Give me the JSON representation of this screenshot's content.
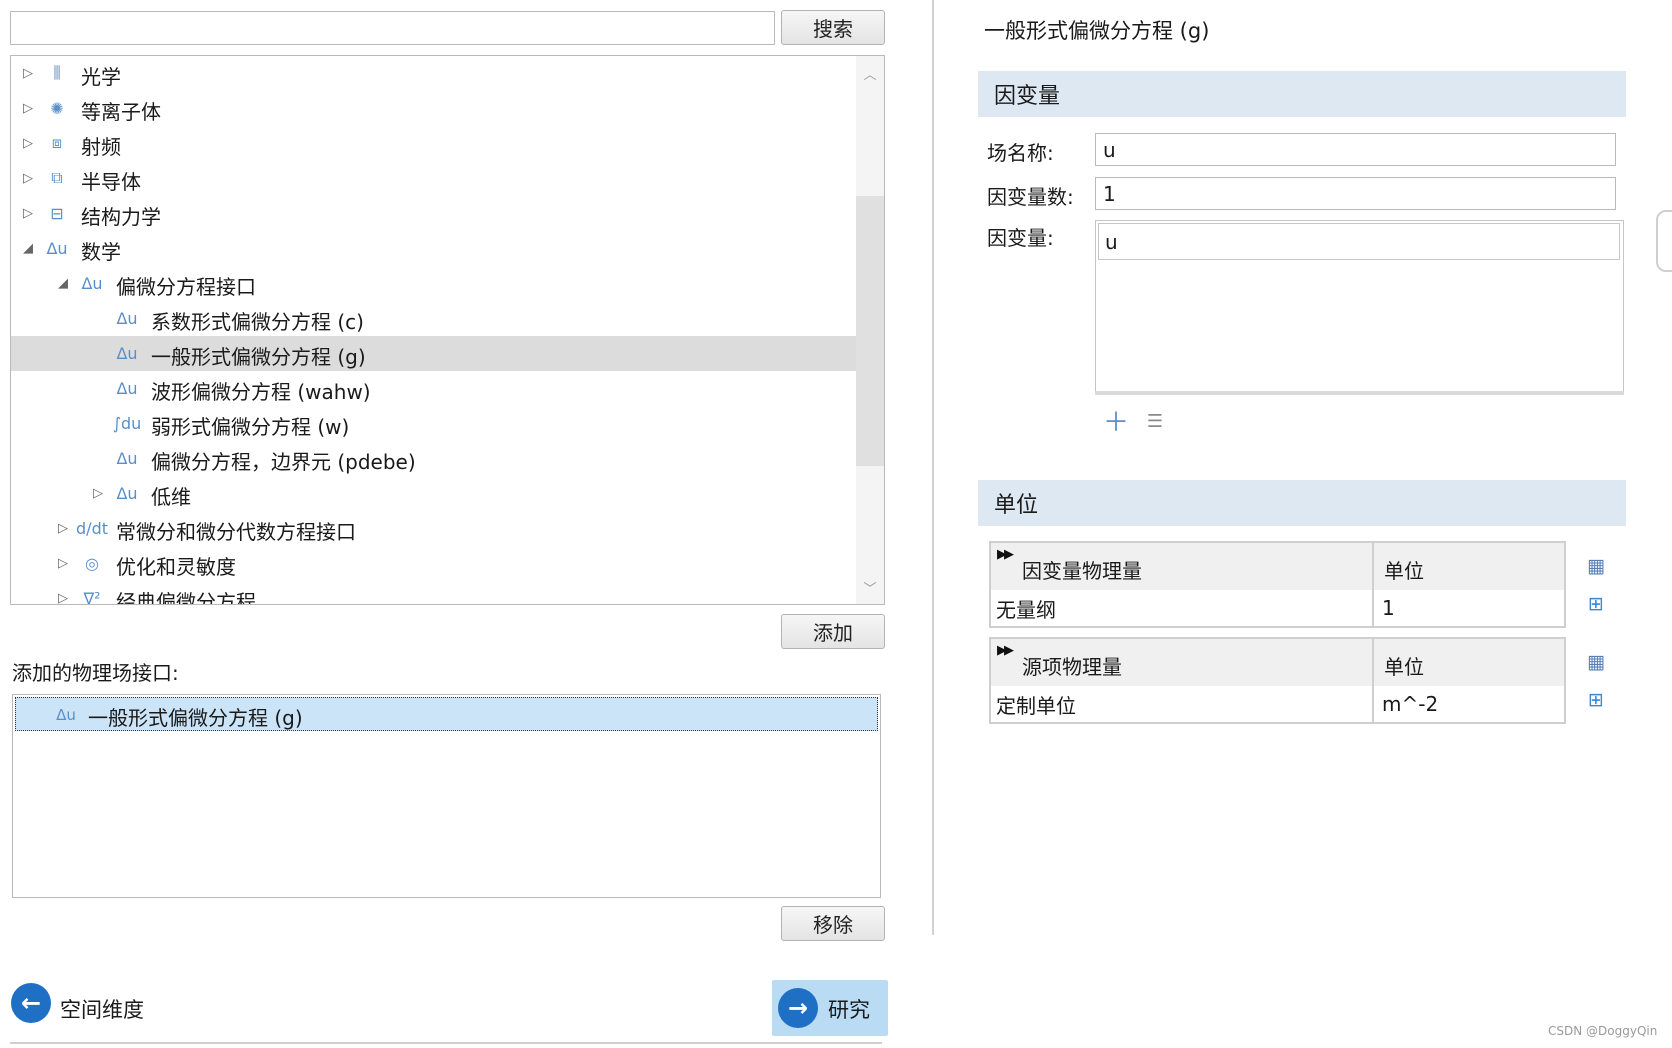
{
  "search": {
    "value": "",
    "button": "搜索"
  },
  "tree": {
    "items": [
      {
        "label": "光学",
        "icon": "optics-icon",
        "glyph": "⫼",
        "arrow": "collapsed"
      },
      {
        "label": "等离子体",
        "icon": "plasma-icon",
        "glyph": "✺",
        "arrow": "collapsed"
      },
      {
        "label": "射频",
        "icon": "rf-icon",
        "glyph": "⧈",
        "arrow": "collapsed"
      },
      {
        "label": "半导体",
        "icon": "semiconductor-icon",
        "glyph": "⧉",
        "arrow": "collapsed"
      },
      {
        "label": "结构力学",
        "icon": "structural-icon",
        "glyph": "⊟",
        "arrow": "collapsed"
      },
      {
        "label": "数学",
        "icon": "math-icon",
        "glyph": "Δu",
        "arrow": "expanded"
      },
      {
        "label": "偏微分方程接口",
        "icon": "pde-icon",
        "glyph": "Δu",
        "arrow": "expanded"
      },
      {
        "label": "系数形式偏微分方程 (c)",
        "icon": "pde-icon",
        "glyph": "Δu",
        "arrow": "none"
      },
      {
        "label": "一般形式偏微分方程 (g)",
        "icon": "pde-icon",
        "glyph": "Δu",
        "arrow": "none",
        "selected": true
      },
      {
        "label": "波形偏微分方程 (wahw)",
        "icon": "pde-icon",
        "glyph": "Δu",
        "arrow": "none"
      },
      {
        "label": "弱形式偏微分方程 (w)",
        "icon": "weak-form-icon",
        "glyph": "∫du",
        "arrow": "none"
      },
      {
        "label": "偏微分方程，边界元 (pdebe)",
        "icon": "boundary-element-icon",
        "glyph": "Δu",
        "arrow": "none"
      },
      {
        "label": "低维",
        "icon": "pde-icon",
        "glyph": "Δu",
        "arrow": "collapsed"
      },
      {
        "label": "常微分和微分代数方程接口",
        "icon": "ode-icon",
        "glyph": "d/dt",
        "arrow": "collapsed"
      },
      {
        "label": "优化和灵敏度",
        "icon": "optimization-icon",
        "glyph": "◎",
        "arrow": "collapsed"
      },
      {
        "label": "经典偏微分方程",
        "icon": "classic-pde-icon",
        "glyph": "∇²",
        "arrow": "collapsed"
      }
    ]
  },
  "add_button": "添加",
  "added": {
    "label": "添加的物理场接口:",
    "items": [
      {
        "label": "一般形式偏微分方程 (g)",
        "glyph": "Δu"
      }
    ]
  },
  "remove_button": "移除",
  "nav": {
    "back": "空间维度",
    "next": "研究"
  },
  "panel": {
    "title": "一般形式偏微分方程 (g)",
    "dep_section": "因变量",
    "field_name_label": "场名称:",
    "field_name_value": "u",
    "dep_count_label": "因变量数:",
    "dep_count_value": "1",
    "dep_vars_label": "因变量:",
    "dep_vars": [
      "u"
    ],
    "units_section": "单位",
    "table1": {
      "col1": "因变量物理量",
      "col2": "单位",
      "row_col1": "无量纲",
      "row_col2": "1"
    },
    "table2": {
      "col1": "源项物理量",
      "col2": "单位",
      "row_col1": "定制单位",
      "row_col2": "m^-2"
    }
  },
  "watermark": "CSDN @DoggyQin",
  "colors": {
    "accent": "#1f6fc5",
    "section": "#dde8f3",
    "selected": "#dcdcdc",
    "added_item": "#cce4f7"
  }
}
